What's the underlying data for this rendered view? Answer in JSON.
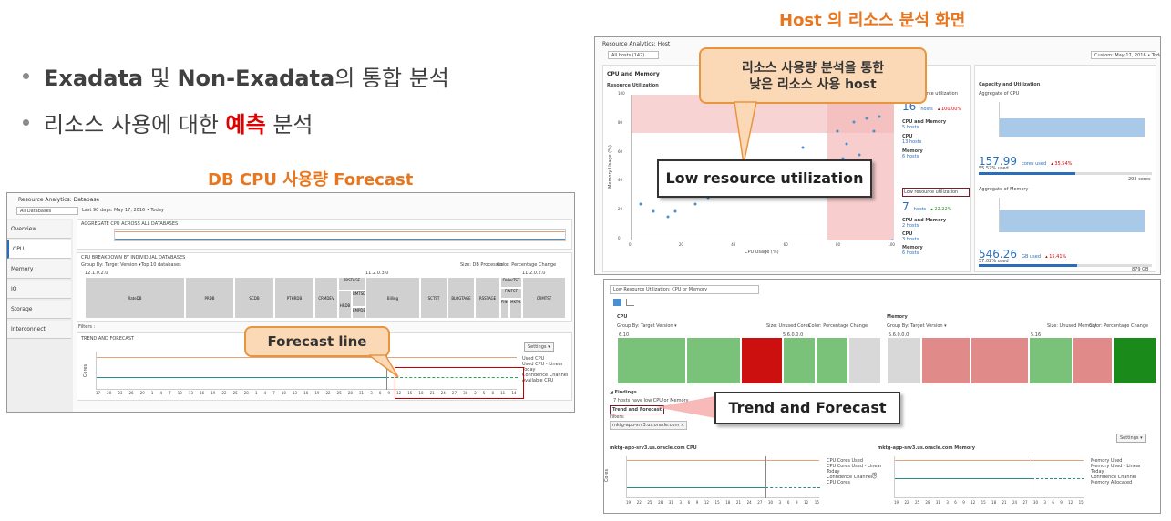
{
  "bullets": [
    {
      "parts": [
        {
          "t": "Exadata",
          "s": "bold"
        },
        {
          "t": " 및 ",
          "s": ""
        },
        {
          "t": "Non-Exadata",
          "s": "bold"
        },
        {
          "t": "의 통합 분석",
          "s": ""
        }
      ]
    },
    {
      "parts": [
        {
          "t": "리소스 사용에 대한 ",
          "s": ""
        },
        {
          "t": "예측",
          "s": "red"
        },
        {
          "t": " 분석",
          "s": ""
        }
      ]
    }
  ],
  "titles": {
    "host": "Host 의 리소스 분석 화면",
    "db": "DB CPU 사용량 Forecast"
  },
  "callouts": {
    "forecast_line": "Forecast line",
    "host_low": "리소스 사용량 분석을 통한\n낮은 리소스 사용 host",
    "low_resource": "Low resource utilization",
    "trend": "Trend and Forecast"
  },
  "db_panel": {
    "header": "Resource Analytics: Database",
    "select": "All Databases",
    "range": "Last 90 days: May 17, 2016 • Today",
    "sidebar": [
      "Overview",
      "CPU",
      "Memory",
      "IO",
      "Storage",
      "Interconnect"
    ],
    "aggregate_title": "AGGREGATE CPU ACROSS ALL DATABASES",
    "breakdown_title": "CPU BREAKDOWN BY INDIVIDUAL DATABASES",
    "group_by": "Group By: Target Version ▾",
    "top10": "Top 10 databases",
    "size_label": "Size: DB Processes",
    "color_label": "Color: Percentage Change",
    "versions": [
      "12.1.0.2.0",
      "11.2.0.3.0",
      "11.2.0.2.0"
    ],
    "cells": [
      "RateDB",
      "PRDB",
      "SCDB",
      "PTHRDB",
      "CRMDEV",
      "PRSTAGE",
      "HRDB",
      "BMTSDB",
      "EMPDB",
      "Billing",
      "SCTST",
      "BLOGTAGE",
      "RSSTAGE",
      "OrderTST",
      "FINTST",
      "FINDB",
      "MKTG...",
      "CRMTST"
    ],
    "filters": "Filters :",
    "trend_title": "TREND AND FORECAST",
    "settings": "Settings ▾",
    "legend": [
      "Used CPU",
      "Used CPU - Linear",
      "Today",
      "Confidence Channel",
      "Available CPU"
    ],
    "xticks": [
      "17",
      "20",
      "23",
      "26",
      "29",
      "1",
      "4",
      "7",
      "10",
      "13",
      "16",
      "19",
      "22",
      "25",
      "28",
      "1",
      "4",
      "7",
      "10",
      "13",
      "16",
      "19",
      "22",
      "25",
      "28",
      "31",
      "3",
      "6",
      "9",
      "12",
      "15",
      "18",
      "21",
      "24",
      "27",
      "30",
      "2",
      "5",
      "8",
      "11",
      "14"
    ],
    "months": [
      "May 2016",
      "Jun",
      "Jul",
      "Aug",
      "Sep"
    ],
    "yaxis": "Cores"
  },
  "host_panel": {
    "header": "Resource Analytics: Host",
    "select": "All hosts (142)",
    "custom": "Custom: May 17, 2016 • Today",
    "section": "CPU and Memory",
    "resource_util": "Resource Utilization",
    "xlabel": "CPU Usage (%)",
    "ylabel": "Memory Usage (%)",
    "yticks": [
      "100",
      "80",
      "60",
      "40",
      "20",
      "0"
    ],
    "xticks": [
      "0",
      "20",
      "40",
      "60",
      "80",
      "100"
    ],
    "high_title": "High resource utilization",
    "high_count": "16",
    "high_unit": "hosts",
    "high_pct": "▴ 100.00%",
    "cm_title": "CPU and Memory",
    "cm_hosts": "5 hosts",
    "cpu_title": "CPU",
    "cpu_hosts": "13 hosts",
    "mem_title": "Memory",
    "mem_hosts": "6 hosts",
    "low_title": "Low resource utilization",
    "low_count": "7",
    "low_unit": "hosts",
    "low_pct": "▴ 22.22%",
    "low_cm": "2 hosts",
    "low_cpu": "3 hosts",
    "low_mem": "6 hosts",
    "cap_title": "Capacity and Utilization",
    "agg_cpu": "Aggregate of CPU",
    "cpu_used": "157.99",
    "cpu_used_unit": "cores used",
    "cpu_used_pct": "▴ 35.54%",
    "cpu_sub": "55.57% used",
    "cpu_total": "292 cores",
    "agg_mem": "Aggregate of Memory",
    "mem_used": "546.26",
    "mem_used_unit": "GB used",
    "mem_used_pct": "▴ 15.41%",
    "mem_sub": "57.02% used",
    "mem_total": "879 GB",
    "dates": [
      "17",
      "23",
      "29",
      "4",
      "10",
      "16",
      "22",
      "28",
      "4",
      "10",
      "16",
      "22",
      "28",
      "3",
      "9"
    ],
    "months": [
      "May 2016",
      "Jun",
      "Jul",
      "Aug"
    ]
  },
  "lower_panel": {
    "filter_select": "Low Resource Utilization: CPU or Memory",
    "cpu_title": "CPU",
    "mem_title": "Memory",
    "group_by": "Group By: Target Version ▾",
    "size_unused_cores": "Size: Unused Cores",
    "size_unused_mem": "Size: Unused Memory",
    "color": "Color: Percentage Change",
    "versions": [
      "6.10",
      "5.6.0.0.0",
      "5.6.0.0.0",
      "5.16"
    ],
    "findings": "◢ Findings",
    "findings_text": "7 hosts have low CPU or Memory",
    "trend_link": "Trend and Forecast",
    "filters": "Filters:",
    "filter_chip": "mktg-app-srv3.us.oracle.com ×",
    "settings": "Settings ▾",
    "cpu_chart_title": "mktg-app-srv3.us.oracle.com CPU",
    "mem_chart_title": "mktg-app-srv3.us.oracle.com Memory",
    "cpu_legend": [
      "CPU Cores Used",
      "CPU Cores Used - Linear",
      "Today",
      "Confidence Channel",
      "CPU Cores"
    ],
    "mem_legend": [
      "Memory Used",
      "Memory Used - Linear",
      "Today",
      "Confidence Channel",
      "Memory Allocated"
    ],
    "xticks": [
      "19",
      "22",
      "25",
      "28",
      "31",
      "3",
      "6",
      "9",
      "12",
      "15",
      "18",
      "21",
      "24",
      "27",
      "30",
      "3",
      "6",
      "9",
      "12",
      "15"
    ],
    "months": [
      "May 2016",
      "Jun",
      "Aug"
    ],
    "y_cpu": "Cores",
    "y_mem": "GB"
  }
}
